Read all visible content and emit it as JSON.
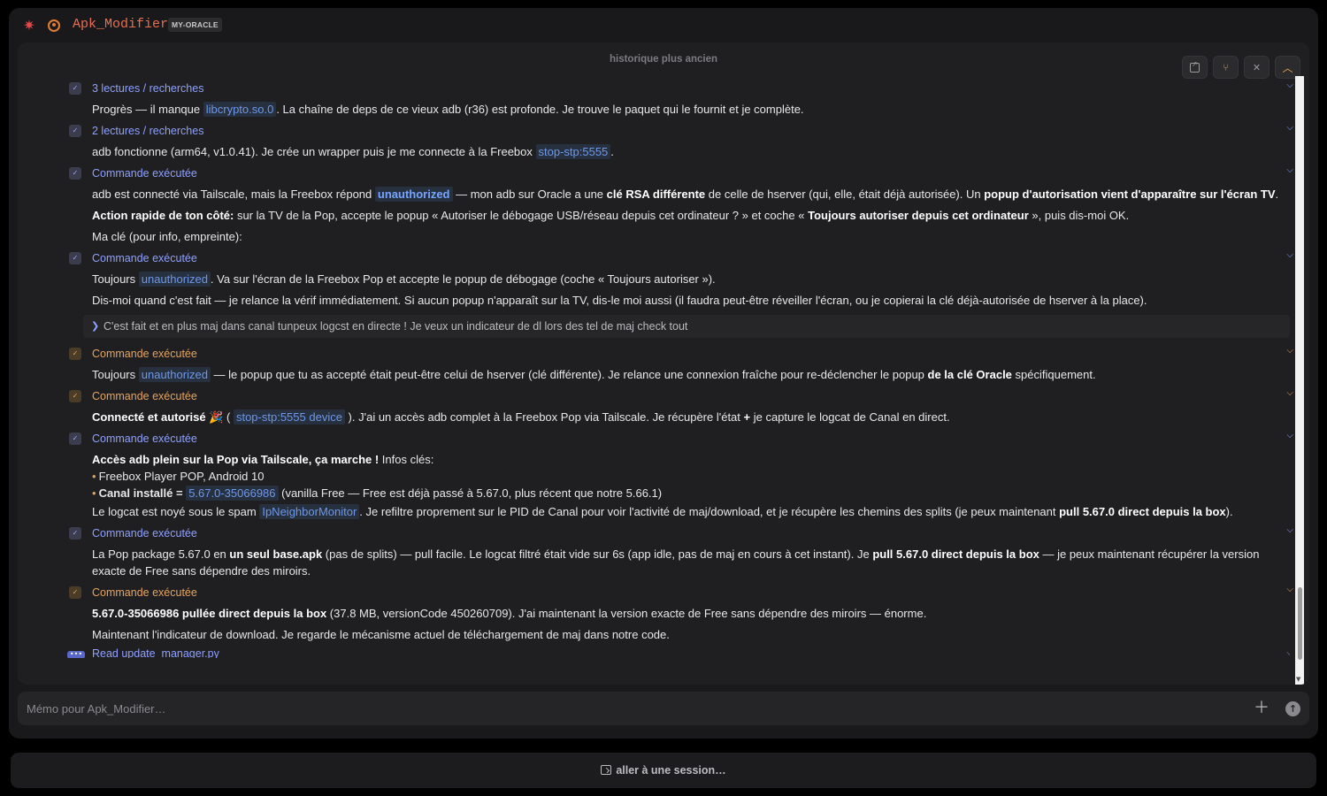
{
  "app": {
    "title": "Apk_Modifier",
    "tag": "MY-ORACLE"
  },
  "history_label": "historique plus ancien",
  "entries": [
    {
      "label": "3 lectures / recherches",
      "lines": [
        {
          "pre": "Progrès — il manque ",
          "code": "libcrypto.so.0",
          "post": ". La chaîne de deps de ce vieux adb (r36) est profonde. Je trouve le paquet qui le fournit et je complète."
        }
      ]
    },
    {
      "label": "2 lectures / recherches",
      "lines": [
        {
          "pre": "adb fonctionne (arm64, v1.0.41). Je crée un wrapper puis je me connecte à la Freebox ",
          "code": "stop-stp:5555",
          "post": "."
        }
      ]
    },
    {
      "label": "Commande exécutée",
      "l1_pre": "adb est connecté via Tailscale, mais la Freebox répond ",
      "l1_code": "unauthorized",
      "l1_mid": " — mon adb sur Oracle a une ",
      "l1_b1": "clé RSA différente",
      "l1_mid2": " de celle de hserver (qui, elle, était déjà autorisée). Un ",
      "l1_b2": "popup d'autorisation vient d'apparaître sur l'écran TV",
      "l1_end": ".",
      "l2_b1": "Action rapide de ton côté:",
      "l2_mid": " sur la TV de la Pop, accepte le popup « Autoriser le débogage USB/réseau depuis cet ordinateur ? » et coche « ",
      "l2_b2": "Toujours autoriser depuis cet ordinateur",
      "l2_end": " », puis dis-moi OK.",
      "l3": "Ma clé (pour info, empreinte):"
    },
    {
      "label": "Commande exécutée",
      "l1_pre": "Toujours ",
      "l1_code": "unauthorized",
      "l1_post": ". Va sur l'écran de la Freebox Pop et accepte le popup de débogage (coche « Toujours autoriser »).",
      "l2": "Dis-moi quand c'est fait — je relance la vérif immédiatement. Si aucun popup n'apparaît sur la TV, dis-le moi aussi (il faudra peut-être réveiller l'écran, ou je copierai la clé déjà-autorisée de hserver à la place)."
    },
    {
      "quote": "C'est fait et en plus maj dans canal tunpeux logcst en directe ! Je veux un indicateur de dl lors des tel de maj check tout"
    },
    {
      "label": "Commande exécutée",
      "l1_pre": "Toujours ",
      "l1_code": "unauthorized",
      "l1_mid": " — le popup que tu as accepté était peut-être celui de hserver (clé différente). Je relance une connexion fraîche pour re-déclencher le popup ",
      "l1_b": "de la clé Oracle",
      "l1_end": " spécifiquement."
    },
    {
      "label": "Commande exécutée",
      "l1_b": "Connecté et autorisé",
      "l1_emoji": "🎉",
      "l1_paren": " ( ",
      "l1_code": "stop-stp:5555 device",
      "l1_mid": " ). J'ai un accès adb complet à la Freebox Pop via Tailscale. Je récupère l'état ",
      "l1_plus": "+",
      "l1_end": " je capture le logcat de Canal en direct."
    },
    {
      "label": "Commande exécutée",
      "l1_b": "Accès adb plein sur la Pop via Tailscale, ça marche !",
      "l1_end": " Infos clés:",
      "b1": "Freebox Player POP, Android 10",
      "b2_b": "Canal installé =",
      "b2_code": "5.67.0-35066986",
      "b2_end": " (vanilla Free — Free est déjà passé à 5.67.0, plus récent que notre 5.66.1)",
      "l3_pre": "Le logcat est noyé sous le spam ",
      "l3_code": "IpNeighborMonitor",
      "l3_mid": ". Je refiltre proprement sur le PID de Canal pour voir l'activité de maj/download, et je récupère les chemins des splits (je peux maintenant ",
      "l3_b": "pull 5.67.0 direct depuis la box",
      "l3_end": ")."
    },
    {
      "label": "Commande exécutée",
      "l1_pre": "La Pop package 5.67.0 en ",
      "l1_b1": "un seul base.apk",
      "l1_mid": " (pas de splits) — pull facile. Le logcat filtré était vide sur 6s (app idle, pas de maj en cours à cet instant). Je ",
      "l1_b2": "pull 5.67.0 direct depuis la box",
      "l1_end": " — je peux maintenant récupérer la version exacte de Free sans dépendre des miroirs."
    },
    {
      "label": "Commande exécutée",
      "l1_b": "5.67.0-35066986 pullée direct depuis la box",
      "l1_end": " (37.8 MB, versionCode 450260709). J'ai maintenant la version exacte de Free sans dépendre des miroirs — énorme.",
      "l2": "Maintenant l'indicateur de download. Je regarde le mécanisme actuel de téléchargement de maj dans notre code."
    },
    {
      "label": "Read update_manager.py"
    }
  ],
  "memo": {
    "placeholder": "Mémo pour Apk_Modifier…"
  },
  "footer": {
    "label": "aller à une session…"
  },
  "colors": {
    "accent_blue": "#8fa0ff",
    "accent_orange": "#e6a45e",
    "brand_red": "#e34a4a"
  },
  "icons": [
    "asterisk-icon",
    "status-ring-icon",
    "external-link-icon",
    "git-branch-icon",
    "close-icon",
    "chevron-up-icon",
    "chevron-down-icon",
    "plus-icon",
    "send-arrow-icon",
    "session-icon"
  ]
}
